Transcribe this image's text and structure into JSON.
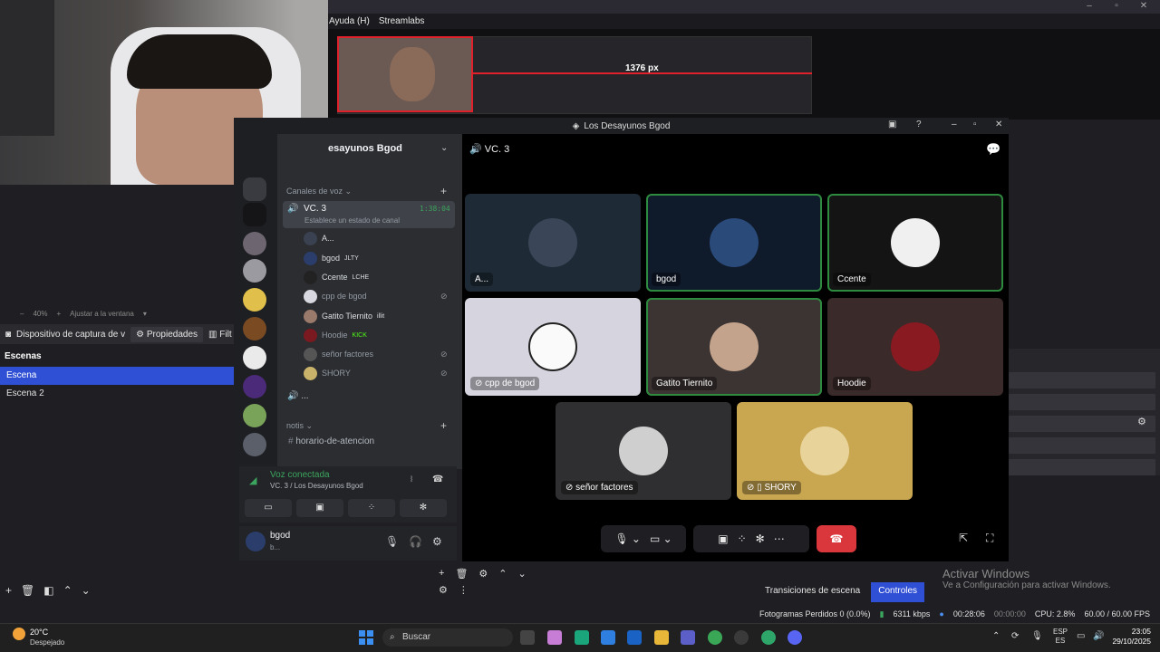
{
  "obs": {
    "menu": [
      "Ayuda (H)",
      "Streamlabs"
    ],
    "preview_label": "1376 px",
    "zoom": {
      "level": "40%",
      "fit": "Ajustar a la ventana"
    },
    "source_name": "Dispositivo de captura de v",
    "properties_label": "Propiedades",
    "filters_label": "Filt",
    "scenes_title": "Escenas",
    "scenes": [
      "Escena",
      "Escena 2"
    ],
    "transitions_tab": "Transiciones de escena",
    "controls_tab": "Controles",
    "activate_title": "Activar Windows",
    "activate_sub": "Ve a Configuración para activar Windows.",
    "status": {
      "dropped": "Fotogramas Perdidos 0 (0.0%)",
      "kbps": "6311 kbps",
      "stream_time": "00:28:06",
      "rec_time": "00:00:00",
      "cpu": "CPU: 2.8%",
      "fps": "60.00 / 60.00 FPS"
    }
  },
  "discord": {
    "window_title": "Los Desayunos Bgod",
    "guild_name": "esayunos Bgod",
    "category_voice": "Canales de voz",
    "voice_channel": {
      "name": "VC. 3",
      "timer": "1:38:04",
      "status": "Establece un estado de canal"
    },
    "members": [
      {
        "name": "A...",
        "tag": ""
      },
      {
        "name": "bgod",
        "tag": "JLTY"
      },
      {
        "name": "Ccente",
        "tag": "LCHE"
      },
      {
        "name": "cpp de bgod",
        "tag": ""
      },
      {
        "name": "Gatito Tiernito",
        "tag": "illit"
      },
      {
        "name": "Hoodie",
        "tag": "KICK"
      },
      {
        "name": "señor factores",
        "tag": ""
      },
      {
        "name": "SHORY",
        "tag": ""
      }
    ],
    "more_channel": "...",
    "category_notis": "notis",
    "text_channel": "horario-de-atencion",
    "voice_connected": "Voz conectada",
    "voice_sub": "VC. 3 / Los Desayunos Bgod",
    "user": {
      "name": "bgod",
      "sub": "b..."
    },
    "call_header": "VC. 3",
    "tiles": [
      {
        "name": "A..."
      },
      {
        "name": "bgod"
      },
      {
        "name": "Ccente"
      },
      {
        "name": "cpp de bgod"
      },
      {
        "name": "Gatito Tiernito"
      },
      {
        "name": "Hoodie"
      },
      {
        "name": "señor factores"
      },
      {
        "name": "SHORY"
      }
    ]
  },
  "taskbar": {
    "temp": "20°C",
    "weather": "Despejado",
    "search": "Buscar",
    "lang_top": "ESP",
    "lang_bottom": "ES",
    "time": "23:05",
    "date": "29/10/2025"
  }
}
